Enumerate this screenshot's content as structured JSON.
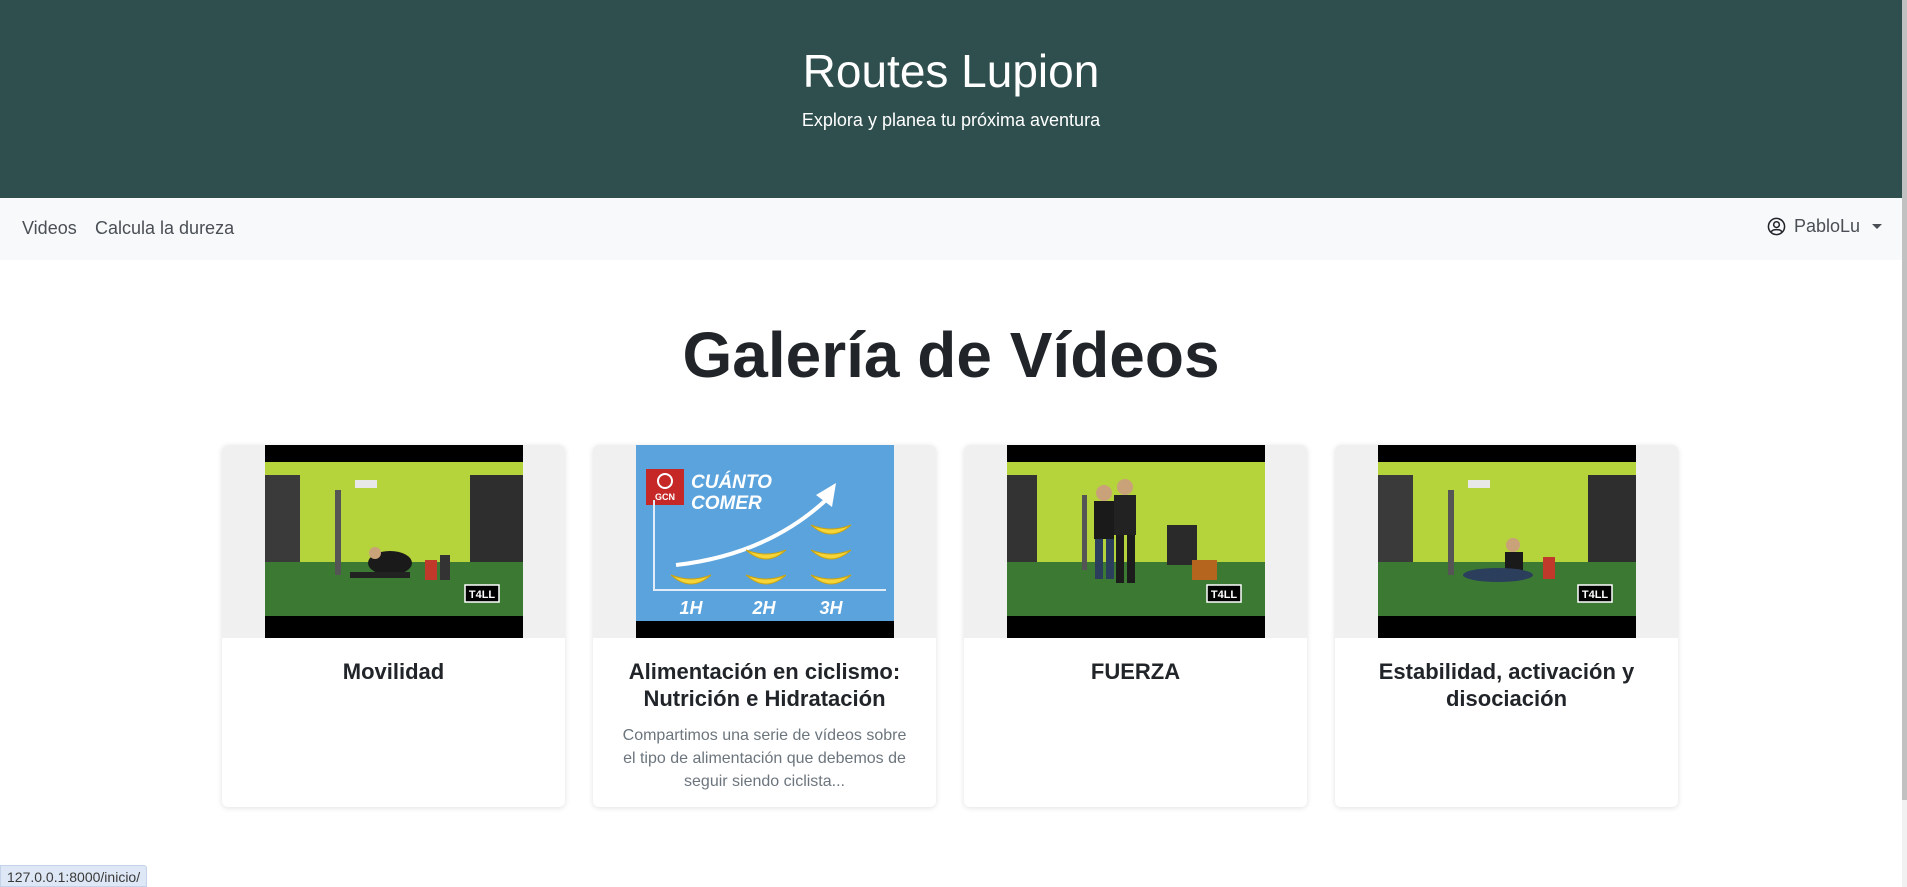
{
  "hero": {
    "title": "Routes Lupion",
    "subtitle": "Explora y planea tu próxima aventura"
  },
  "navbar": {
    "links": [
      {
        "label": "Videos"
      },
      {
        "label": "Calcula la dureza"
      }
    ],
    "user": {
      "name": "PabloLu",
      "icon": "user-circle-icon"
    }
  },
  "gallery": {
    "title": "Galería de Vídeos",
    "cards": [
      {
        "title": "Movilidad",
        "description": "",
        "thumbnail": "gym-mobility-thumbnail",
        "badge": "T4LL"
      },
      {
        "title": "Alimentación en ciclismo: Nutrición e Hidratación",
        "description": "Compartimos una serie de vídeos sobre el tipo de alimentación que debemos de seguir siendo ciclista...",
        "thumbnail": "bananas-chart-thumbnail",
        "overlay": {
          "line1": "CUÁNTO",
          "line2": "COMER",
          "labels": [
            "1H",
            "2H",
            "3H"
          ],
          "logo": "GCN"
        }
      },
      {
        "title": "FUERZA",
        "description": "",
        "thumbnail": "gym-strength-thumbnail",
        "badge": "T4LL"
      },
      {
        "title": "Estabilidad, activación y disociación",
        "description": "",
        "thumbnail": "gym-stability-thumbnail",
        "badge": "T4LL"
      }
    ]
  },
  "statusbar": {
    "url": "127.0.0.1:8000/inicio/"
  },
  "colors": {
    "hero_bg": "#2f4f4f",
    "navbar_bg": "#f8f9fa",
    "gym_wall": "#b5d33a",
    "gym_floor": "#3c7a34"
  }
}
